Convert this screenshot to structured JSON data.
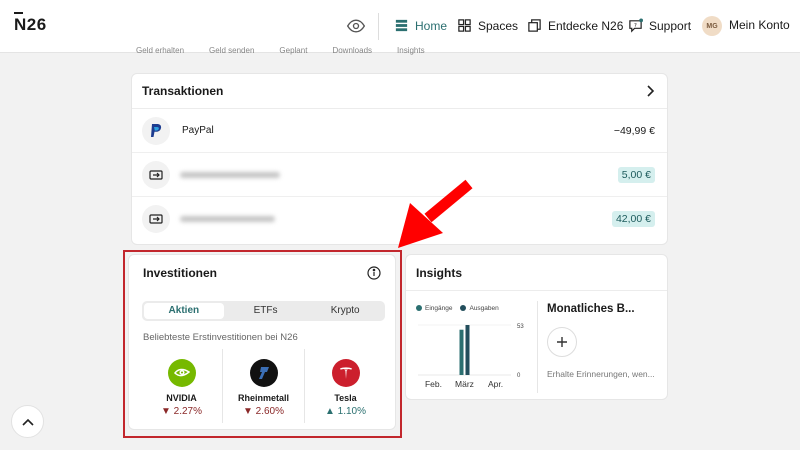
{
  "brand": {
    "logo_text": "N26"
  },
  "nav": {
    "items": [
      {
        "label": "Home",
        "active": true
      },
      {
        "label": "Spaces"
      },
      {
        "label": "Entdecke N26"
      },
      {
        "label": "Support"
      }
    ],
    "avatar_initials": "MG",
    "account_label": "Mein Konto"
  },
  "subtabs": [
    "Geld erhalten",
    "Geld senden",
    "Geplant",
    "Downloads",
    "Insights"
  ],
  "transactions": {
    "title": "Transaktionen",
    "rows": [
      {
        "name": "PayPal",
        "amount": "−49,99 €",
        "highlight": false
      },
      {
        "name": "",
        "amount": "5,00 €",
        "highlight": true
      },
      {
        "name": "",
        "amount": "42,00 €",
        "highlight": true
      }
    ]
  },
  "investments": {
    "title": "Investitionen",
    "tabs": [
      "Aktien",
      "ETFs",
      "Krypto"
    ],
    "active_tab": "Aktien",
    "subtitle": "Beliebteste Erstinvestitionen bei N26",
    "stocks": [
      {
        "name": "NVIDIA",
        "change": "▼ 2.27%",
        "direction": "down",
        "color": "#76b900"
      },
      {
        "name": "Rheinmetall",
        "change": "▼ 2.60%",
        "direction": "down",
        "color": "#111111"
      },
      {
        "name": "Tesla",
        "change": "▲ 1.10%",
        "direction": "up",
        "color": "#cc1f2d"
      }
    ]
  },
  "insights": {
    "title": "Insights",
    "legend": [
      "Eingänge",
      "Ausgaben"
    ],
    "chart_data": {
      "type": "bar",
      "categories": [
        "Feb.",
        "März",
        "Apr."
      ],
      "series": [
        {
          "name": "Eingänge",
          "values": [
            0,
            48,
            0
          ]
        },
        {
          "name": "Ausgaben",
          "values": [
            0,
            53,
            0
          ]
        }
      ],
      "yticks": [
        "53",
        "0"
      ],
      "ylim": [
        0,
        53
      ]
    },
    "monthly": {
      "title": "Monatliches B...",
      "description": "Erhalte Erinnerungen, wen..."
    }
  },
  "colors": {
    "accent": "#2b6f70",
    "highlight_border": "#c2272d",
    "arrow": "#ff0000"
  }
}
